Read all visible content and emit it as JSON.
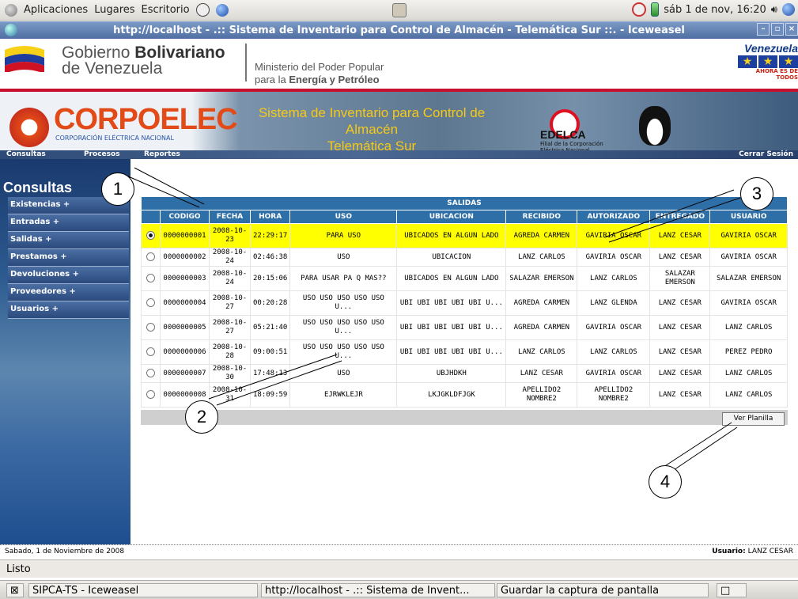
{
  "gnome": {
    "apps": "Aplicaciones",
    "places": "Lugares",
    "desktop": "Escritorio",
    "clock": "sáb 1 de nov, 16:20"
  },
  "window": {
    "title": "http://localhost - .:: Sistema de Inventario para Control de Almacén - Telemática Sur ::. - Iceweasel"
  },
  "header": {
    "gov_line1": "Gobierno ",
    "gov_bold": "Bolivariano",
    "gov_line2": "de Venezuela",
    "ministry1": "Ministerio del Poder Popular",
    "ministry2a": "para la ",
    "ministry2b": "Energía y Petróleo",
    "venezuela": "Venezuela",
    "venezuela_sub": "AHORA ES DE TODOS",
    "corpoelec": "CORPOELEC",
    "corpoelec_sub": "CORPORACIÓN ELÉCTRICA NACIONAL",
    "system_title1": "Sistema de Inventario para Control de Almacén",
    "system_title2": "Telemática Sur",
    "edelca": "EDELCA",
    "edelca_sub1": "Filial de la Corporación",
    "edelca_sub2": "Eléctrica Nacional"
  },
  "nav": {
    "consultas": "Consultas",
    "procesos": "Procesos",
    "reportes": "Reportes",
    "logout": "Cerrar Sesión"
  },
  "sidebar": {
    "heading": "Consultas",
    "items": [
      "Existencias +",
      "Entradas +",
      "Salidas +",
      "Prestamos +",
      "Devoluciones +",
      "Proveedores +",
      "Usuarios +"
    ]
  },
  "table": {
    "caption": "SALIDAS",
    "headers": [
      "CODIGO",
      "FECHA",
      "HORA",
      "USO",
      "UBICACION",
      "RECIBIDO",
      "AUTORIZADO",
      "ENTREGADO",
      "USUARIO"
    ],
    "rows": [
      [
        "0000000001",
        "2008-10-23",
        "22:29:17",
        "PARA USO",
        "UBICADOS EN ALGUN LADO",
        "AGREDA CARMEN",
        "GAVIRIA OSCAR",
        "LANZ CESAR",
        "GAVIRIA OSCAR"
      ],
      [
        "0000000002",
        "2008-10-24",
        "02:46:38",
        "USO",
        "UBICACION",
        "LANZ CARLOS",
        "GAVIRIA OSCAR",
        "LANZ CESAR",
        "GAVIRIA OSCAR"
      ],
      [
        "0000000003",
        "2008-10-24",
        "20:15:06",
        "PARA USAR PA Q MAS??",
        "UBICADOS EN ALGUN LADO",
        "SALAZAR EMERSON",
        "LANZ CARLOS",
        "SALAZAR EMERSON",
        "SALAZAR EMERSON"
      ],
      [
        "0000000004",
        "2008-10-27",
        "00:20:28",
        "USO USO USO USO USO U...",
        "UBI UBI UBI UBI UBI U...",
        "AGREDA CARMEN",
        "LANZ GLENDA",
        "LANZ CESAR",
        "GAVIRIA OSCAR"
      ],
      [
        "0000000005",
        "2008-10-27",
        "05:21:40",
        "USO USO USO USO USO U...",
        "UBI UBI UBI UBI UBI U...",
        "AGREDA CARMEN",
        "GAVIRIA OSCAR",
        "LANZ CESAR",
        "LANZ CARLOS"
      ],
      [
        "0000000006",
        "2008-10-28",
        "09:00:51",
        "USO USO USO USO USO U...",
        "UBI UBI UBI UBI UBI U...",
        "LANZ CARLOS",
        "LANZ CARLOS",
        "LANZ CESAR",
        "PEREZ PEDRO"
      ],
      [
        "0000000007",
        "2008-10-30",
        "17:48:13",
        "USO",
        "UBJHDKH",
        "LANZ CESAR",
        "GAVIRIA OSCAR",
        "LANZ CESAR",
        "LANZ CARLOS"
      ],
      [
        "0000000008",
        "2008-10-31",
        "18:09:59",
        "EJRWKLEJR",
        "LKJGKLDFJGK",
        "APELLIDO2 NOMBRE2",
        "APELLIDO2 NOMBRE2",
        "LANZ CESAR",
        "LANZ CARLOS"
      ]
    ],
    "selected_row": 0
  },
  "buttons": {
    "planilla": "Ver Planilla"
  },
  "callouts": [
    "1",
    "2",
    "3",
    "4"
  ],
  "status": {
    "date": "Sabado, 1 de Noviembre de 2008",
    "user_label": "Usuario:",
    "user": "LANZ CESAR",
    "browser": "Listo"
  },
  "taskbar": {
    "item1": "SIPCA-TS - Iceweasel",
    "item2": "http://localhost - .:: Sistema de Invent...",
    "item3": "Guardar la captura de pantalla"
  },
  "colors": {
    "selected_row": "#ffff00",
    "header_blue": "#2e6fa8",
    "brand_red": "#c6102e",
    "corpoelec_orange": "#e24a18"
  }
}
